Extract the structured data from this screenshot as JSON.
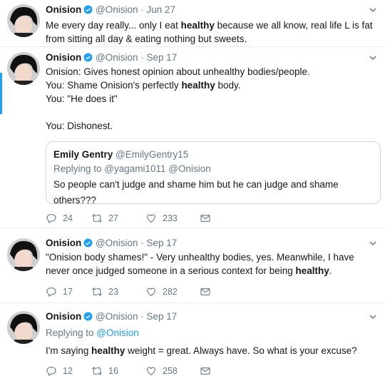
{
  "tweets": [
    {
      "name": "Onision",
      "handle": "@Onision",
      "date": "Jun 27",
      "text_parts": [
        {
          "t": "Me every day really... only I eat ",
          "b": false
        },
        {
          "t": "healthy",
          "b": true
        },
        {
          "t": " because we all know, real life L is fat from sitting all day & eating nothing but sweets.",
          "b": false
        }
      ]
    },
    {
      "name": "Onision",
      "handle": "@Onision",
      "date": "Sep 17",
      "text_parts": [
        {
          "t": "Onision: Gives honest opinion about unhealthy bodies/people.\nYou: Shame Onision's perfectly ",
          "b": false
        },
        {
          "t": "healthy",
          "b": true
        },
        {
          "t": " body.\nYou: \"He does it\"\n\nYou: Dishonest.",
          "b": false
        }
      ],
      "quote": {
        "name": "Emily Gentry",
        "handle": "@EmilyGentry15",
        "replying": "Replying to @yagami1011 @Onision",
        "text": "So people can't judge and shame him but he can judge and shame others???"
      },
      "replies": "24",
      "retweets": "27",
      "likes": "233"
    },
    {
      "name": "Onision",
      "handle": "@Onision",
      "date": "Sep 17",
      "text_parts": [
        {
          "t": "\"Onision body shames!\" - Very unhealthy bodies, yes. Meanwhile, I have never once judged someone in a serious context for being ",
          "b": false
        },
        {
          "t": "healthy",
          "b": true
        },
        {
          "t": ".",
          "b": false
        }
      ],
      "replies": "17",
      "retweets": "23",
      "likes": "282"
    },
    {
      "name": "Onision",
      "handle": "@Onision",
      "date": "Sep 17",
      "replying_prefix": "Replying to ",
      "replying_handle": "@Onision",
      "text_parts": [
        {
          "t": "I'm saying ",
          "b": false
        },
        {
          "t": "healthy",
          "b": true
        },
        {
          "t": " weight = great. Always have. So what is your excuse?",
          "b": false
        }
      ],
      "replies": "12",
      "retweets": "16",
      "likes": "258"
    }
  ],
  "separator": " · ",
  "colors": {
    "accent": "#1da1f2",
    "meta": "#657786",
    "border": "#e6ecf0"
  },
  "icons": [
    "verified-icon",
    "caret-down-icon",
    "reply-icon",
    "retweet-icon",
    "like-icon",
    "message-icon"
  ]
}
